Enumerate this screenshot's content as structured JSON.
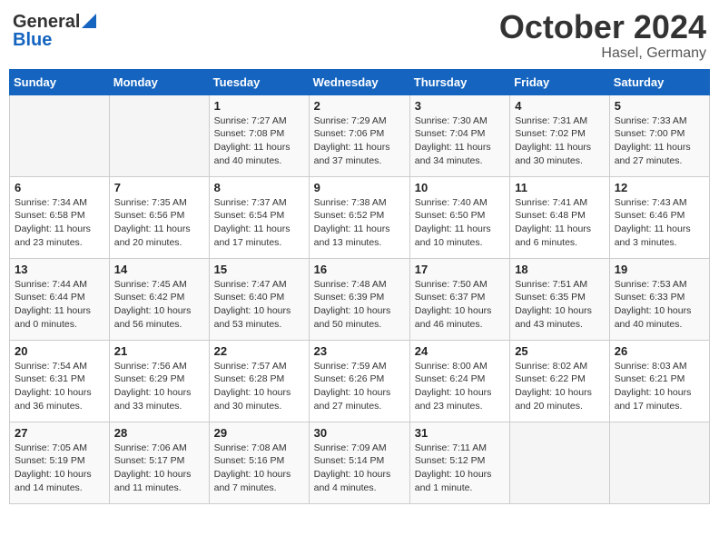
{
  "logo": {
    "general": "General",
    "blue": "Blue"
  },
  "header": {
    "month": "October 2024",
    "location": "Hasel, Germany"
  },
  "weekdays": [
    "Sunday",
    "Monday",
    "Tuesday",
    "Wednesday",
    "Thursday",
    "Friday",
    "Saturday"
  ],
  "weeks": [
    [
      {
        "day": "",
        "info": ""
      },
      {
        "day": "",
        "info": ""
      },
      {
        "day": "1",
        "info": "Sunrise: 7:27 AM\nSunset: 7:08 PM\nDaylight: 11 hours and 40 minutes."
      },
      {
        "day": "2",
        "info": "Sunrise: 7:29 AM\nSunset: 7:06 PM\nDaylight: 11 hours and 37 minutes."
      },
      {
        "day": "3",
        "info": "Sunrise: 7:30 AM\nSunset: 7:04 PM\nDaylight: 11 hours and 34 minutes."
      },
      {
        "day": "4",
        "info": "Sunrise: 7:31 AM\nSunset: 7:02 PM\nDaylight: 11 hours and 30 minutes."
      },
      {
        "day": "5",
        "info": "Sunrise: 7:33 AM\nSunset: 7:00 PM\nDaylight: 11 hours and 27 minutes."
      }
    ],
    [
      {
        "day": "6",
        "info": "Sunrise: 7:34 AM\nSunset: 6:58 PM\nDaylight: 11 hours and 23 minutes."
      },
      {
        "day": "7",
        "info": "Sunrise: 7:35 AM\nSunset: 6:56 PM\nDaylight: 11 hours and 20 minutes."
      },
      {
        "day": "8",
        "info": "Sunrise: 7:37 AM\nSunset: 6:54 PM\nDaylight: 11 hours and 17 minutes."
      },
      {
        "day": "9",
        "info": "Sunrise: 7:38 AM\nSunset: 6:52 PM\nDaylight: 11 hours and 13 minutes."
      },
      {
        "day": "10",
        "info": "Sunrise: 7:40 AM\nSunset: 6:50 PM\nDaylight: 11 hours and 10 minutes."
      },
      {
        "day": "11",
        "info": "Sunrise: 7:41 AM\nSunset: 6:48 PM\nDaylight: 11 hours and 6 minutes."
      },
      {
        "day": "12",
        "info": "Sunrise: 7:43 AM\nSunset: 6:46 PM\nDaylight: 11 hours and 3 minutes."
      }
    ],
    [
      {
        "day": "13",
        "info": "Sunrise: 7:44 AM\nSunset: 6:44 PM\nDaylight: 11 hours and 0 minutes."
      },
      {
        "day": "14",
        "info": "Sunrise: 7:45 AM\nSunset: 6:42 PM\nDaylight: 10 hours and 56 minutes."
      },
      {
        "day": "15",
        "info": "Sunrise: 7:47 AM\nSunset: 6:40 PM\nDaylight: 10 hours and 53 minutes."
      },
      {
        "day": "16",
        "info": "Sunrise: 7:48 AM\nSunset: 6:39 PM\nDaylight: 10 hours and 50 minutes."
      },
      {
        "day": "17",
        "info": "Sunrise: 7:50 AM\nSunset: 6:37 PM\nDaylight: 10 hours and 46 minutes."
      },
      {
        "day": "18",
        "info": "Sunrise: 7:51 AM\nSunset: 6:35 PM\nDaylight: 10 hours and 43 minutes."
      },
      {
        "day": "19",
        "info": "Sunrise: 7:53 AM\nSunset: 6:33 PM\nDaylight: 10 hours and 40 minutes."
      }
    ],
    [
      {
        "day": "20",
        "info": "Sunrise: 7:54 AM\nSunset: 6:31 PM\nDaylight: 10 hours and 36 minutes."
      },
      {
        "day": "21",
        "info": "Sunrise: 7:56 AM\nSunset: 6:29 PM\nDaylight: 10 hours and 33 minutes."
      },
      {
        "day": "22",
        "info": "Sunrise: 7:57 AM\nSunset: 6:28 PM\nDaylight: 10 hours and 30 minutes."
      },
      {
        "day": "23",
        "info": "Sunrise: 7:59 AM\nSunset: 6:26 PM\nDaylight: 10 hours and 27 minutes."
      },
      {
        "day": "24",
        "info": "Sunrise: 8:00 AM\nSunset: 6:24 PM\nDaylight: 10 hours and 23 minutes."
      },
      {
        "day": "25",
        "info": "Sunrise: 8:02 AM\nSunset: 6:22 PM\nDaylight: 10 hours and 20 minutes."
      },
      {
        "day": "26",
        "info": "Sunrise: 8:03 AM\nSunset: 6:21 PM\nDaylight: 10 hours and 17 minutes."
      }
    ],
    [
      {
        "day": "27",
        "info": "Sunrise: 7:05 AM\nSunset: 5:19 PM\nDaylight: 10 hours and 14 minutes."
      },
      {
        "day": "28",
        "info": "Sunrise: 7:06 AM\nSunset: 5:17 PM\nDaylight: 10 hours and 11 minutes."
      },
      {
        "day": "29",
        "info": "Sunrise: 7:08 AM\nSunset: 5:16 PM\nDaylight: 10 hours and 7 minutes."
      },
      {
        "day": "30",
        "info": "Sunrise: 7:09 AM\nSunset: 5:14 PM\nDaylight: 10 hours and 4 minutes."
      },
      {
        "day": "31",
        "info": "Sunrise: 7:11 AM\nSunset: 5:12 PM\nDaylight: 10 hours and 1 minute."
      },
      {
        "day": "",
        "info": ""
      },
      {
        "day": "",
        "info": ""
      }
    ]
  ]
}
